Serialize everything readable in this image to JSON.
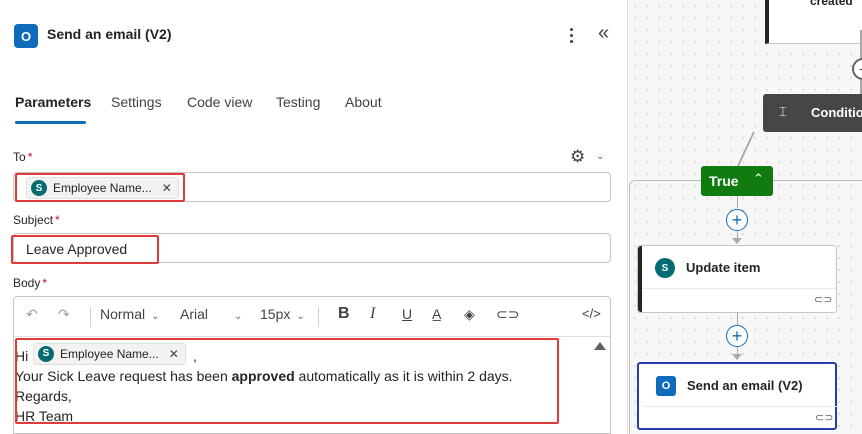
{
  "panel": {
    "title": "Send an email (V2)",
    "tabs": [
      "Parameters",
      "Settings",
      "Code view",
      "Testing",
      "About"
    ],
    "active_tab": "Parameters"
  },
  "fields": {
    "to": {
      "label": "To",
      "required_mark": "*",
      "token": "Employee Name..."
    },
    "subject": {
      "label": "Subject",
      "required_mark": "*",
      "value": "Leave Approved"
    },
    "body": {
      "label": "Body",
      "required_mark": "*"
    }
  },
  "toolbar": {
    "style": "Normal",
    "font": "Arial",
    "size": "15px",
    "code_view": "</>"
  },
  "body_content": {
    "greeting": "Hi",
    "token": "Employee Name...",
    "comma": ",",
    "line2_pre": "Your Sick Leave request has been ",
    "line2_bold": "approved",
    "line2_post": " automatically as it is within 2 days.",
    "line3": "Regards,",
    "line4": "HR Team"
  },
  "canvas": {
    "top_card_text": "created",
    "condition_label": "Condition",
    "true_label": "True",
    "cards": [
      {
        "title": "Update item",
        "icon": "sharepoint-icon"
      },
      {
        "title": "Send an email (V2)",
        "icon": "outlook-icon",
        "selected": true
      }
    ]
  },
  "colors": {
    "accent": "#0f6cbd",
    "highlight": "#e03a3a",
    "true_green": "#107c10",
    "sharepoint": "#036c70",
    "selected_border": "#2b3aa6"
  }
}
